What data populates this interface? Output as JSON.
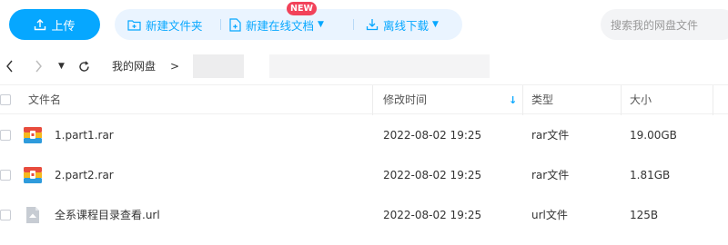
{
  "toolbar": {
    "upload_label": "上传",
    "new_folder_label": "新建文件夹",
    "new_online_doc_label": "新建在线文档",
    "new_badge": "NEW",
    "offline_download_label": "离线下载",
    "search_placeholder": "搜索我的网盘文件"
  },
  "breadcrumb": {
    "root": "我的网盘",
    "separator": ">"
  },
  "table": {
    "columns": {
      "name": "文件名",
      "modified": "修改时间",
      "type": "类型",
      "size": "大小"
    },
    "sort_indicator": "↓",
    "rows": [
      {
        "name": "1.part1.rar",
        "modified": "2022-08-02 19:25",
        "type": "rar文件",
        "size": "19.00GB",
        "icon": "rar-archive-icon"
      },
      {
        "name": "2.part2.rar",
        "modified": "2022-08-02 19:25",
        "type": "rar文件",
        "size": "1.81GB",
        "icon": "rar-archive-icon"
      },
      {
        "name": "全系课程目录查看.url",
        "modified": "2022-08-02 19:25",
        "type": "url文件",
        "size": "125B",
        "icon": "url-file-icon"
      }
    ]
  },
  "colors": {
    "accent": "#06a7ff",
    "accent_light": "#eaf4ff",
    "badge": "#f2425a"
  }
}
